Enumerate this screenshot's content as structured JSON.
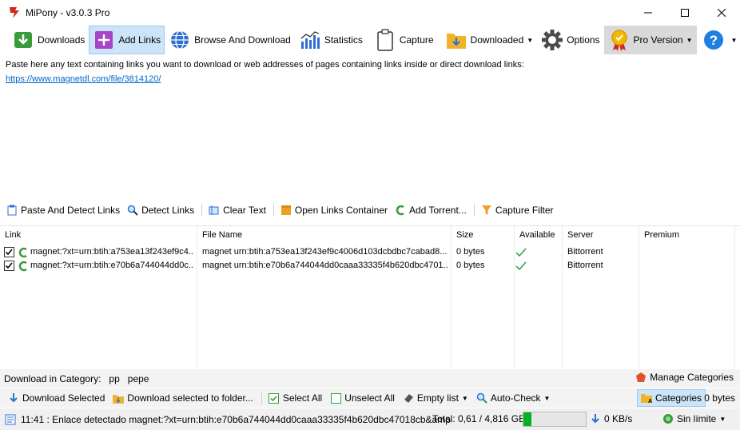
{
  "window": {
    "title": "MiPony - v3.0.3 Pro"
  },
  "toolbar": {
    "downloads": "Downloads",
    "add_links": "Add Links",
    "browse_and_download": "Browse And Download",
    "statistics": "Statistics",
    "capture": "Capture",
    "downloaded": "Downloaded",
    "options": "Options",
    "pro_version": "Pro Version"
  },
  "paste": {
    "info": "Paste here any text containing links you want to download or web addresses of pages containing links inside or direct download links:",
    "link": "https://www.magnetdl.com/file/3814120/"
  },
  "link_tools": {
    "paste_and_detect": "Paste And Detect Links",
    "detect_links": "Detect Links",
    "clear_text": "Clear Text",
    "open_container": "Open Links Container",
    "add_torrent": "Add Torrent...",
    "capture_filter": "Capture Filter"
  },
  "table": {
    "columns": [
      "Link",
      "File Name",
      "Size",
      "Available",
      "Server",
      "Premium"
    ],
    "rows": [
      {
        "link": "magnet:?xt=urn:btih:a753ea13f243ef9c4...",
        "file_name": "magnet urn:btih:a753ea13f243ef9c4006d103dcbdbc7cabad8...",
        "size": "0 bytes",
        "server": "Bittorrent"
      },
      {
        "link": "magnet:?xt=urn:btih:e70b6a744044dd0c...",
        "file_name": "magnet urn:btih:e70b6a744044dd0caaa33335f4b620dbc4701...",
        "size": "0 bytes",
        "server": "Bittorrent"
      }
    ]
  },
  "category": {
    "label": "Download in Category:",
    "items": [
      "pp",
      "pepe"
    ],
    "manage": "Manage Categories"
  },
  "actions": {
    "download_selected": "Download Selected",
    "download_to_folder": "Download selected to folder...",
    "select_all": "Select All",
    "unselect_all": "Unselect All",
    "empty_list": "Empty list",
    "auto_check": "Auto-Check",
    "categories": "Categories",
    "bytes": "0 bytes"
  },
  "status": {
    "message": "11:41 : Enlace detectado magnet:?xt=urn:btih:e70b6a744044dd0caaa33335f4b620dbc47018cb&amp",
    "total": "Total: 0,61 / 4,816 GB",
    "disk_usage_fraction": 0.13,
    "speed": "0 KB/s",
    "limit": "Sin límite"
  },
  "colors": {
    "accent": "#cce4f7",
    "progress": "#06b025",
    "link": "#0066cc",
    "check": "#2e9e44"
  }
}
